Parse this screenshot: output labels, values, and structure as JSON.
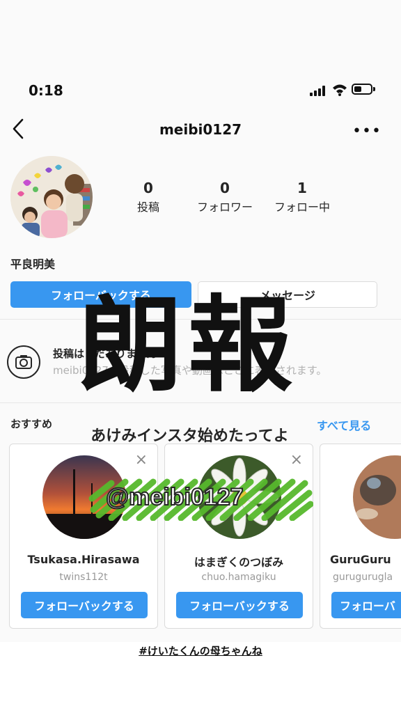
{
  "status_bar": {
    "time": "0:18"
  },
  "header": {
    "username": "meibi0127",
    "more_label": "•••"
  },
  "profile": {
    "stats": [
      {
        "value": "0",
        "label": "投稿"
      },
      {
        "value": "0",
        "label": "フォロワー"
      },
      {
        "value": "1",
        "label": "フォロー中"
      }
    ],
    "display_name": "平良明美",
    "follow_back_label": "フォローバックする",
    "message_label": "メッセージ"
  },
  "empty_state": {
    "title": "投稿はまだありません",
    "description": "meibi0127が投稿した写真や動画はここに表示されます。"
  },
  "suggestions": {
    "label": "おすすめ",
    "see_all": "すべて見る",
    "close_glyph": "×",
    "cards": [
      {
        "name": "Tsukasa.Hirasawa",
        "username": "twins112t",
        "button": "フォローバックする"
      },
      {
        "name": "はまぎくのつぼみ",
        "username": "chuo.hamagiku",
        "button": "フォローバックする"
      },
      {
        "name": "GuruGuru",
        "username": "gurugurugla",
        "button": "フォローバ"
      }
    ]
  },
  "overlay": {
    "headline": "朗報",
    "subtitle": "あけみインスタ始めたってよ",
    "handle": "@meibi0127",
    "hashtag": "#けいたくんの母ちゃんね"
  },
  "colors": {
    "accent": "#3897f0",
    "scribble": "#56b82c",
    "text": "#262626"
  }
}
